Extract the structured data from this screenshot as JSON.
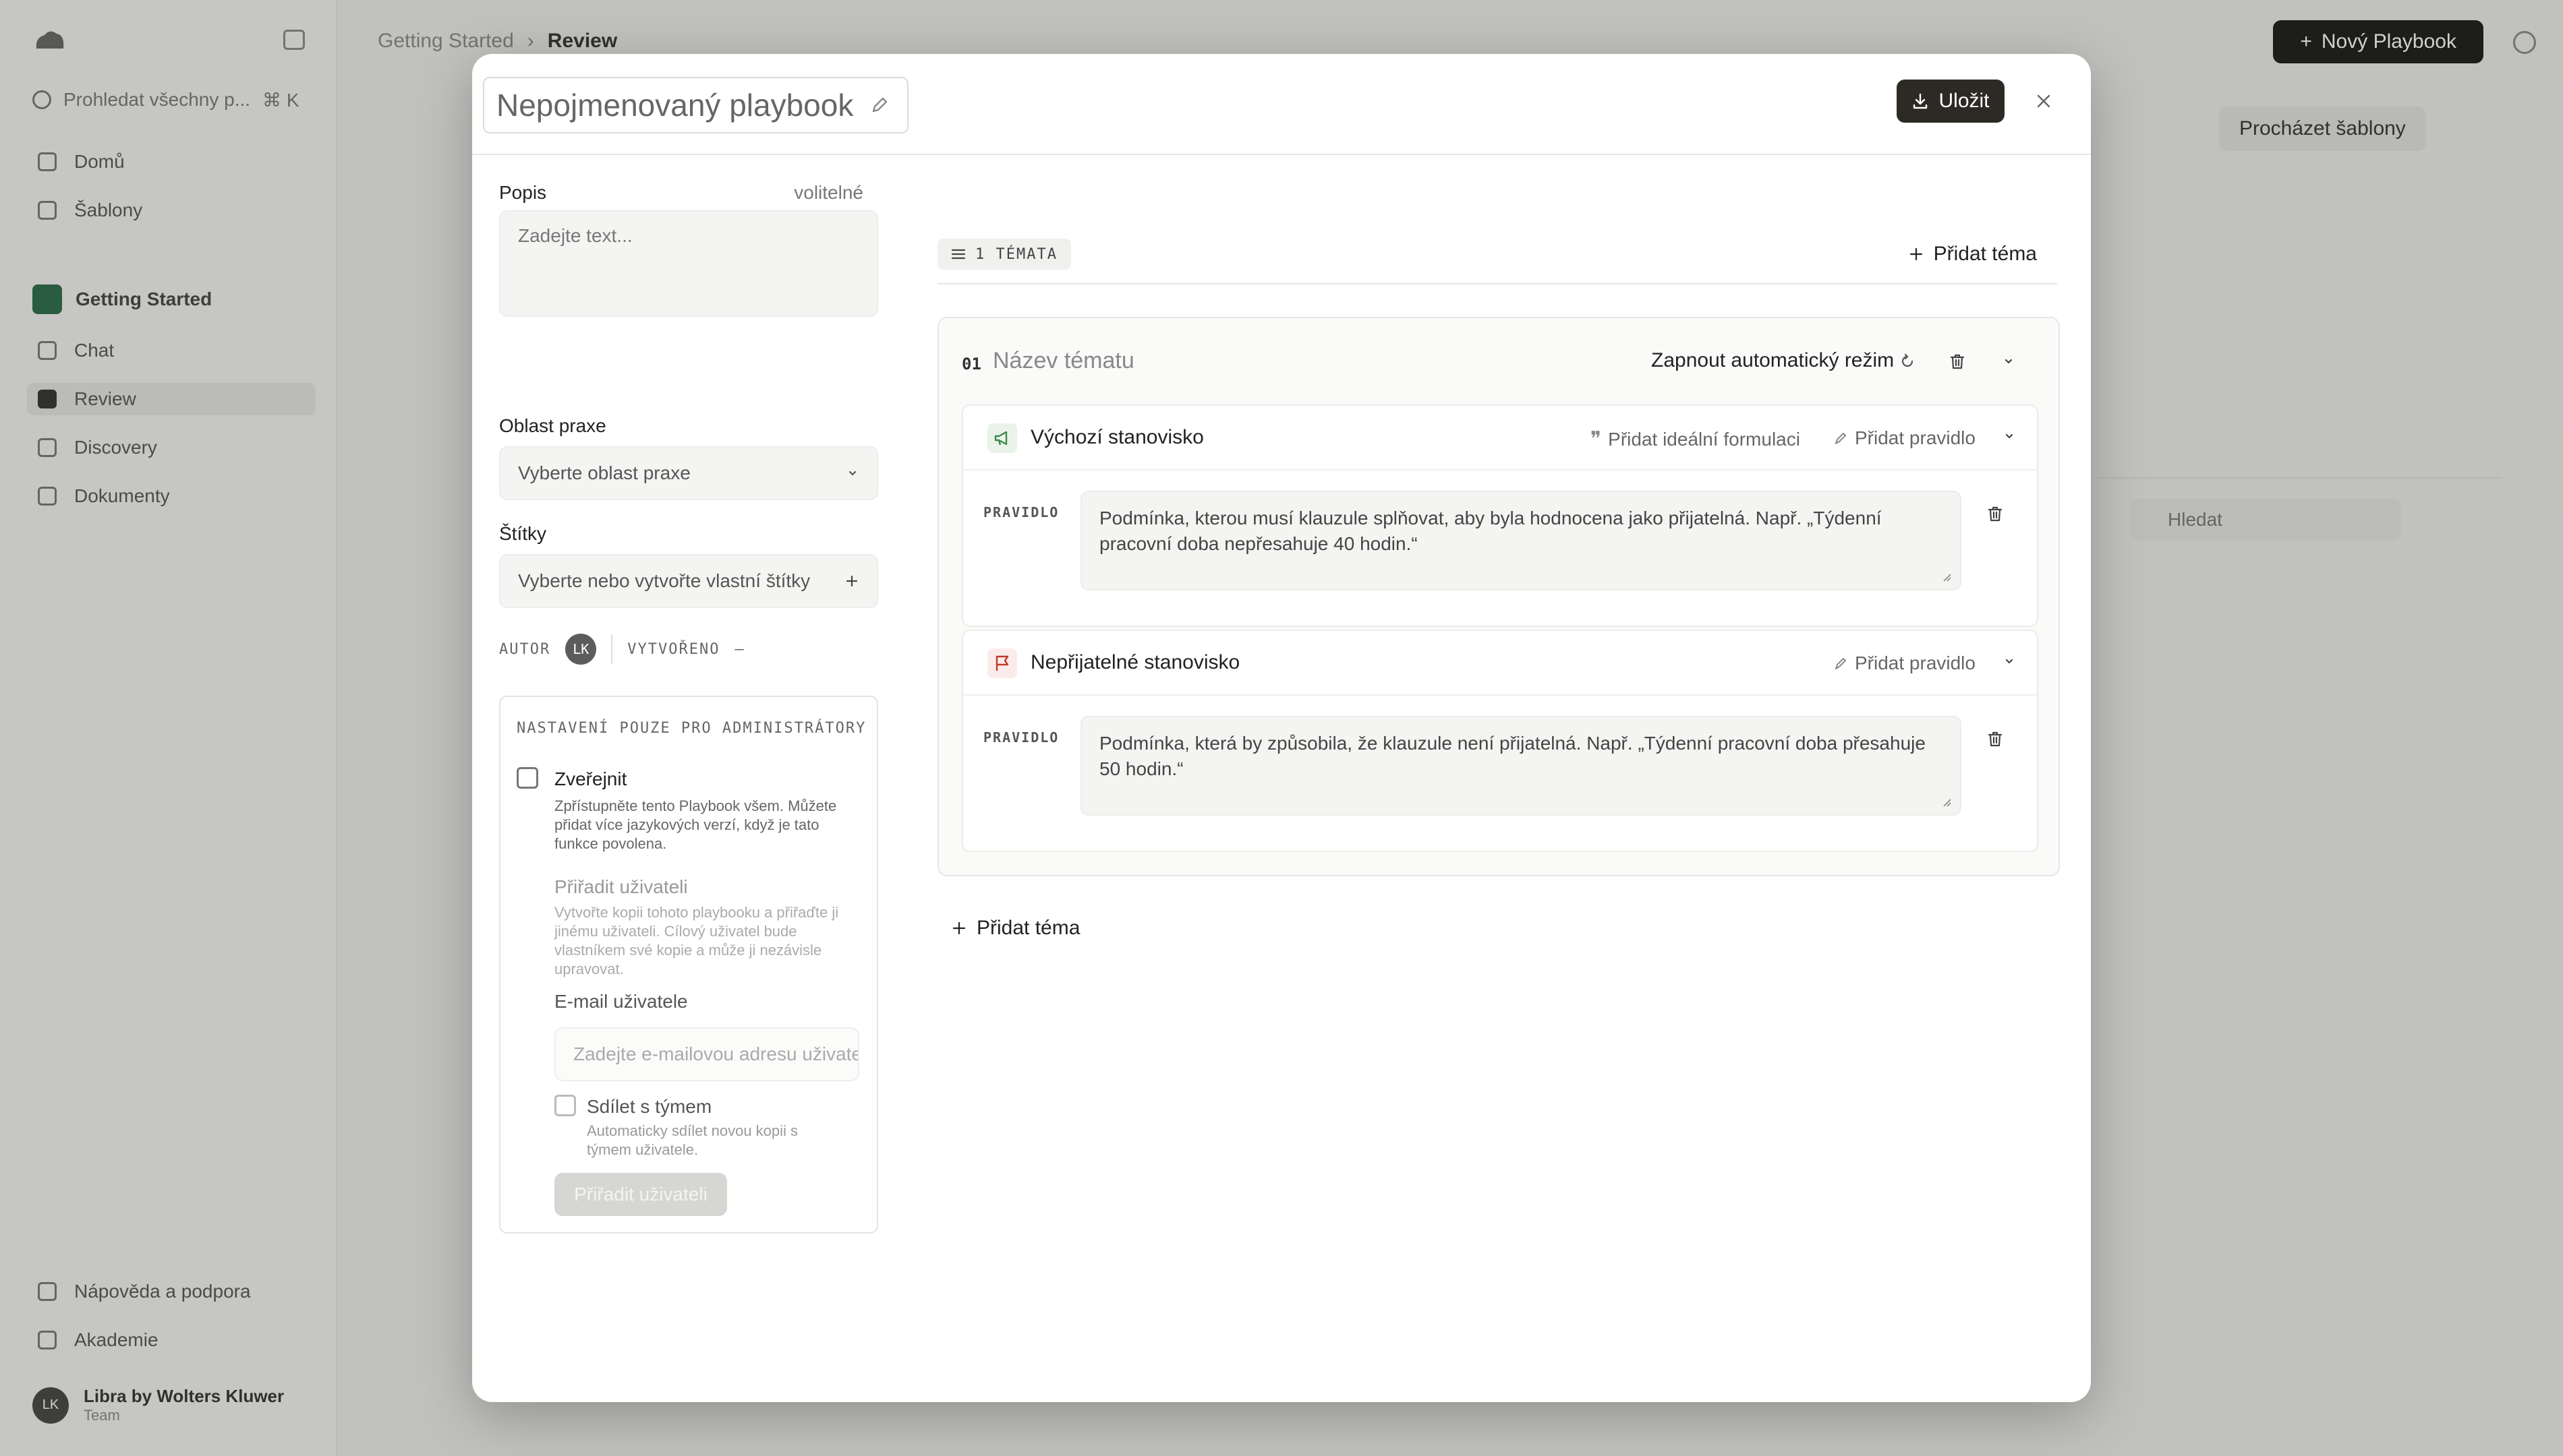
{
  "background": {
    "sidebar": {
      "search_placeholder": "Prohledat všechny p...",
      "search_shortcut": "⌘ K",
      "nav": [
        {
          "label": "Domů",
          "icon": "home-icon"
        },
        {
          "label": "Šablony",
          "icon": "templates-icon"
        }
      ],
      "workspace": "Getting Started",
      "workspace_items": [
        {
          "label": "Chat"
        },
        {
          "label": "Review"
        },
        {
          "label": "Discovery"
        },
        {
          "label": "Dokumenty"
        }
      ],
      "footer": [
        {
          "label": "Nápověda a podpora"
        },
        {
          "label": "Akademie"
        }
      ],
      "user": {
        "initials": "LK",
        "name": "Libra by Wolters Kluwer",
        "role": "Team"
      }
    },
    "header": {
      "breadcrumb": [
        "Getting Started",
        "Review"
      ],
      "new_button": "Nový Playbook",
      "browse_button": "Procházet šablony",
      "search_placeholder": "Hledat"
    }
  },
  "modal": {
    "title": "Nepojmenovaný playbook",
    "save_label": "Uložit",
    "left": {
      "description_label": "Popis",
      "description_optional": "volitelné",
      "description_placeholder": "Zadejte text...",
      "practice_label": "Oblast praxe",
      "practice_placeholder": "Vyberte oblast praxe",
      "tags_label": "Štítky",
      "tags_placeholder": "Vyberte nebo vytvořte vlastní štítky",
      "author_label": "AUTOR",
      "author_initials": "LK",
      "created_label": "VYTVOŘENO",
      "created_value": "–",
      "admin": {
        "title": "NASTAVENÍ POUZE PRO ADMINISTRÁTORY",
        "publish_label": "Zveřejnit",
        "publish_desc": "Zpřístupněte tento Playbook všem. Můžete přidat více jazykových verzí, když je tato funkce povolena.",
        "assign_title": "Přiřadit uživateli",
        "assign_desc": "Vytvořte kopii tohoto playbooku a přiřaďte ji jinému uživateli. Cílový uživatel bude vlastníkem své kopie a může ji nezávisle upravovat.",
        "email_label": "E-mail uživatele",
        "email_placeholder": "Zadejte e-mailovou adresu uživatele",
        "share_label": "Sdílet s týmem",
        "share_desc": "Automaticky sdílet novou kopii s týmem uživatele.",
        "assign_button": "Přiřadit uživateli"
      }
    },
    "right": {
      "topics_count": "1 TÉMATA",
      "add_topic": "Přidat téma",
      "topic": {
        "number": "01",
        "name_placeholder": "Název tématu",
        "auto_mode": "Zapnout automatický režim",
        "positions": [
          {
            "title": "Výchozí stanovisko",
            "add_ideal": "Přidat ideální formulaci",
            "add_rule": "Přidat pravidlo",
            "rule_label": "PRAVIDLO",
            "rule_text": "Podmínka, kterou musí klauzule splňovat, aby byla hodnocena jako přijatelná. Např. „Týdenní pracovní doba nepřesahuje 40 hodin.“",
            "icon_color": "#3b8a4a"
          },
          {
            "title": "Nepřijatelné stanovisko",
            "add_rule": "Přidat pravidlo",
            "rule_label": "PRAVIDLO",
            "rule_text": "Podmínka, která by způsobila, že klauzule není přijatelná. Např. „Týdenní pracovní doba přesahuje 50 hodin.“",
            "icon_color": "#c0392b"
          }
        ]
      },
      "add_topic_bottom": "Přidat téma"
    }
  }
}
